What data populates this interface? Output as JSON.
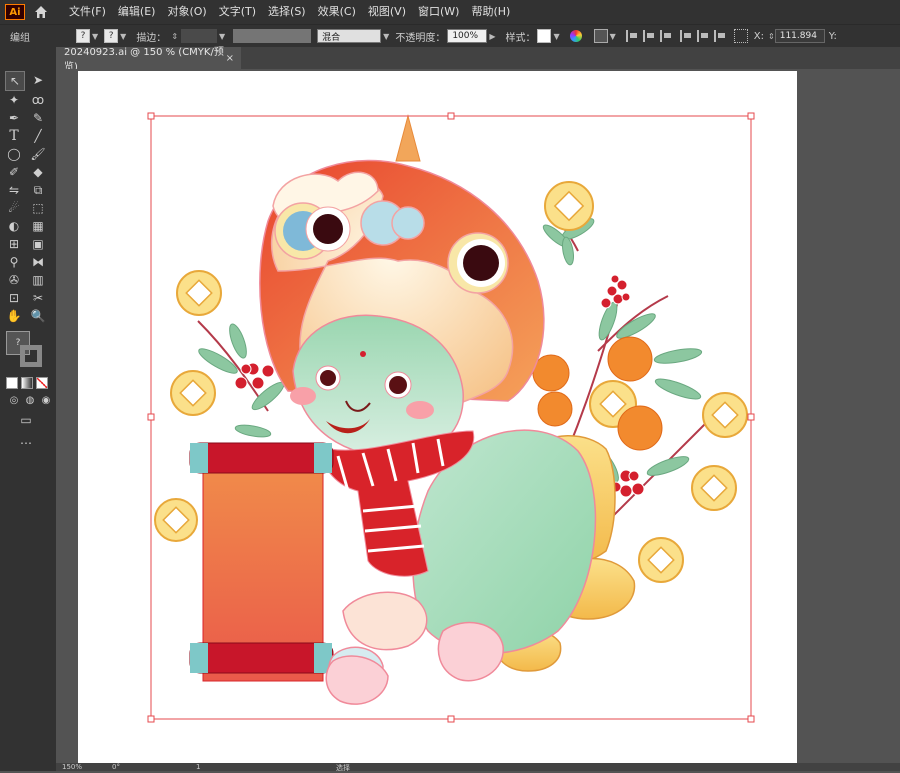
{
  "app": {
    "logo": "Ai",
    "home_icon": "home-icon"
  },
  "menu": [
    {
      "label": "文件(F)"
    },
    {
      "label": "编辑(E)"
    },
    {
      "label": "对象(O)"
    },
    {
      "label": "文字(T)"
    },
    {
      "label": "选择(S)"
    },
    {
      "label": "效果(C)"
    },
    {
      "label": "视图(V)"
    },
    {
      "label": "窗口(W)"
    },
    {
      "label": "帮助(H)"
    }
  ],
  "control": {
    "group_label": "编组",
    "fill_q": "?",
    "stroke_q": "?",
    "stroke_label": "描边：",
    "blend_value": "混合",
    "opacity_label": "不透明度：",
    "opacity_value": "100%",
    "style_label": "样式：",
    "x_label": "X:",
    "x_value": "111.894",
    "y_label": "Y:"
  },
  "document": {
    "tab_title": "20240923.ai @ 150 % (CMYK/预览)",
    "close": "×"
  },
  "toolbar": {
    "swatch_q": "?"
  },
  "status": {
    "zoom": "150%",
    "angle": "0°",
    "artboard_num": "1",
    "tool_name": "选择"
  },
  "colors": {
    "chrome": "#323232",
    "pasteboard": "#535353",
    "artboard": "#ffffff",
    "selection": "#e5484d",
    "accent_red": "#d8232a",
    "accent_orange": "#f08a2c",
    "gold": "#f5c842"
  }
}
